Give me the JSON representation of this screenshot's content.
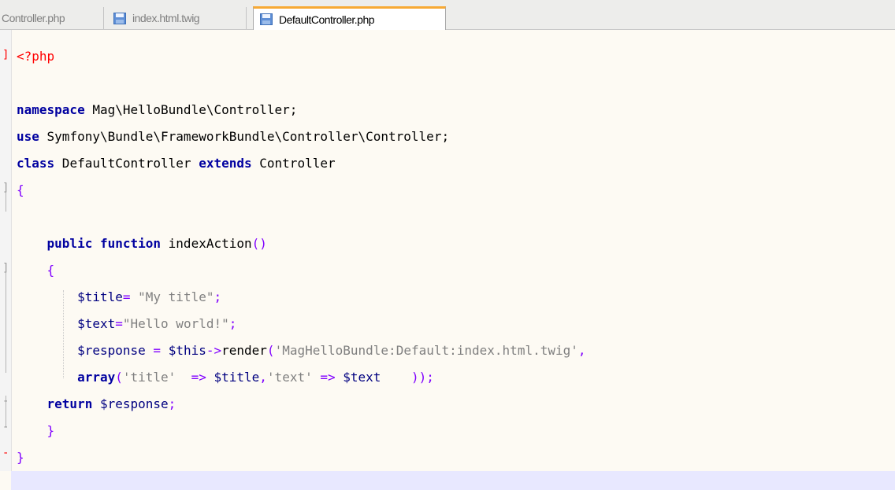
{
  "tabs": [
    {
      "label": "Controller.php",
      "active": false
    },
    {
      "label": "index.html.twig",
      "active": false
    },
    {
      "label": "DefaultController.php",
      "active": true
    }
  ],
  "code": {
    "php_open": "<?php",
    "l3_kw": "namespace",
    "l3_rest": " Mag\\HelloBundle\\Controller;",
    "l4_kw": "use",
    "l4_rest": " Symfony\\Bundle\\FrameworkBundle\\Controller\\Controller;",
    "l5_kw1": "class",
    "l5_id1": " DefaultController ",
    "l5_kw2": "extends",
    "l5_id2": " Controller",
    "l6_brace": "{",
    "l8_kw1": "public",
    "l8_kw2": "function",
    "l8_id": " indexAction",
    "l8_paren": "()",
    "l9_brace": "{",
    "l10_var": "$title",
    "l10_op": "=",
    "l10_str": "\"My title\"",
    "l10_semi": ";",
    "l11_var": "$text",
    "l11_op": "=",
    "l11_str": "\"Hello world!\"",
    "l11_semi": ";",
    "l12_var1": "$response",
    "l12_op1": "=",
    "l12_var2": "$this",
    "l12_op2": "->",
    "l12_id": "render",
    "l12_paren": "(",
    "l12_str": "'MagHelloBundle:Default:index.html.twig'",
    "l12_comma": ",",
    "l13_kw": "array",
    "l13_paren": "(",
    "l13_str1": "'title'",
    "l13_arrow1": "=>",
    "l13_var1": "$title",
    "l13_comma": ",",
    "l13_str2": "'text'",
    "l13_arrow2": "=>",
    "l13_var2": "$text",
    "l13_close": "));",
    "l14_kw": "return",
    "l14_var": "$response",
    "l14_semi": ";",
    "l15_brace": "}",
    "l16_brace": "}"
  }
}
